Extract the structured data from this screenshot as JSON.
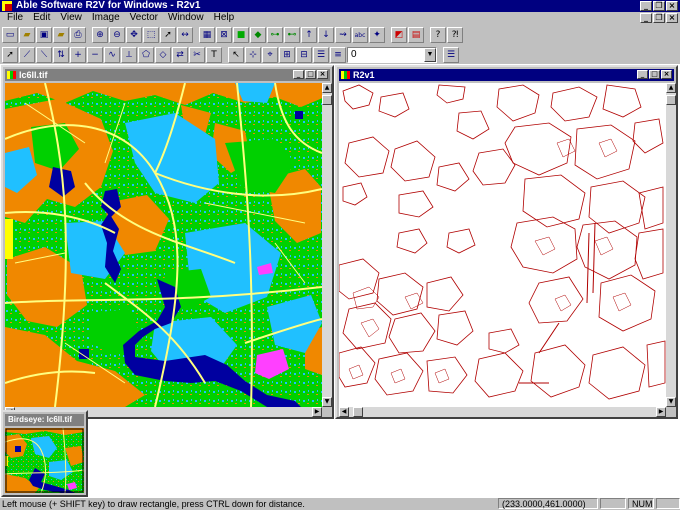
{
  "app": {
    "title": "Able Software R2V for Windows - R2v1"
  },
  "menu": [
    "File",
    "Edit",
    "View",
    "Image",
    "Vector",
    "Window",
    "Help"
  ],
  "toolbar": {
    "combo_value": "0"
  },
  "windows": {
    "raster": {
      "title": "lc6ll.tif"
    },
    "vector": {
      "title": "R2v1"
    },
    "birdseye": {
      "title": "Birdseye: lc6ll.tif"
    }
  },
  "status": {
    "message": "Left mouse (+ SHIFT key) to draw rectangle, press CTRL down for distance.",
    "coords": "(233.0000,461.0000)",
    "num": "NUM"
  },
  "colors": {
    "accent": "#000080",
    "landcover_green": "#00d000",
    "landcover_cyan": "#20c0ff",
    "landcover_orange": "#f08800",
    "water_navy": "#0000a0",
    "roads_yellow": "#ffff80",
    "vector_lines": "#b00000"
  },
  "icons": {
    "toolbar1": [
      "new-file-icon",
      "open-folder-icon",
      "save-icon",
      "open-image-icon",
      "print-icon",
      "zoom-in-icon",
      "zoom-out-icon",
      "pan-icon",
      "zoom-window-icon",
      "select-arrow-icon",
      "measure-icon",
      "grid-icon",
      "fit-icon",
      "color-box-icon",
      "node-icon",
      "add-node-icon",
      "move-node-icon",
      "up-icon",
      "down-icon",
      "auto-trace-icon",
      "abc-label-icon",
      "star-icon",
      "color-pick-icon",
      "palette-icon",
      "help-icon",
      "context-help-icon"
    ],
    "toolbar2": [
      "pointer-icon",
      "edit-line-icon",
      "break-line-icon",
      "join-line-icon",
      "insert-node-icon",
      "delete-node-icon",
      "smooth-icon",
      "snap-icon",
      "polygon-icon",
      "close-line-icon",
      "reverse-icon",
      "split-icon",
      "label-icon",
      "select-line-icon",
      "tag-icon",
      "snap-node-icon",
      "group-icon",
      "ungroup-icon",
      "properties-icon",
      "list-icon",
      "layers-icon"
    ]
  }
}
